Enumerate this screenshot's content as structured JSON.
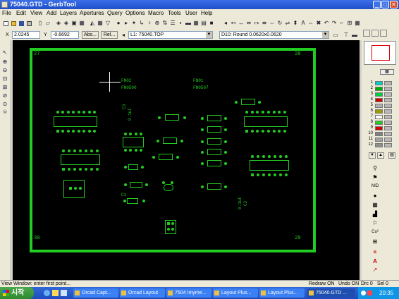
{
  "window": {
    "title": "75040.GTD - GerbTool"
  },
  "colors": {
    "board": "#22cc22",
    "canvas_bg": "#000000",
    "titlebar": "#2b5fd9"
  },
  "menu": [
    "File",
    "Edit",
    "View",
    "Add",
    "Layers",
    "Apertures",
    "Query",
    "Options",
    "Macro",
    "Tools",
    "User",
    "Help"
  ],
  "toolbar2": {
    "x_label": "X",
    "x_value": "2.0245",
    "y_label": "Y",
    "y_value": "-0.6692",
    "abs_label": "Abs...",
    "rel_label": "Rel...",
    "layer_select": "L1: 75040.TOP",
    "aperture_select": "D10: Round 0.0620x0.0620"
  },
  "canvas": {
    "corners": {
      "tl": "27",
      "tr": "28",
      "bl": "30",
      "br": "29"
    },
    "labels": {
      "fn02": "FN02",
      "fn0500": "FN0500",
      "fn01": "FN01",
      "fn0507": "FN0507",
      "cap_c3": "C3",
      "cap_c3_val": "0.1uF",
      "cap_c2": "C2",
      "cap_c2_val": "0.1uF",
      "c1": "C1"
    }
  },
  "right_panel": {
    "layers": [
      {
        "num": "1",
        "color": "#00cccc"
      },
      {
        "num": "2",
        "color": "#00aa00"
      },
      {
        "num": "3",
        "color": "#00cc44"
      },
      {
        "num": "4",
        "color": "#cc0000"
      },
      {
        "num": "5",
        "color": "#b0b0b0"
      },
      {
        "num": "6",
        "color": "#999900"
      },
      {
        "num": "7",
        "color": "#ffffff"
      },
      {
        "num": "8",
        "color": "#22cc22"
      },
      {
        "num": "9",
        "color": "#cc0000"
      },
      {
        "num": "10",
        "color": "#808080"
      },
      {
        "num": "11",
        "color": "#a0a0a0"
      },
      {
        "num": "12",
        "color": "#909090"
      }
    ]
  },
  "status": {
    "message": "View Window: enter first point...",
    "redraw": "Redraw ON",
    "undo": "Undo ON",
    "drc": "Drc 0",
    "sel": "Sel 0"
  },
  "taskbar": {
    "start": "시작",
    "tasks": [
      "Orcad Capt...",
      "Orcad Layout",
      "7504 Imyme...",
      "Layout Plus...",
      "Layout Plus...",
      "75040.GTD ..."
    ],
    "clock": "20:35"
  }
}
